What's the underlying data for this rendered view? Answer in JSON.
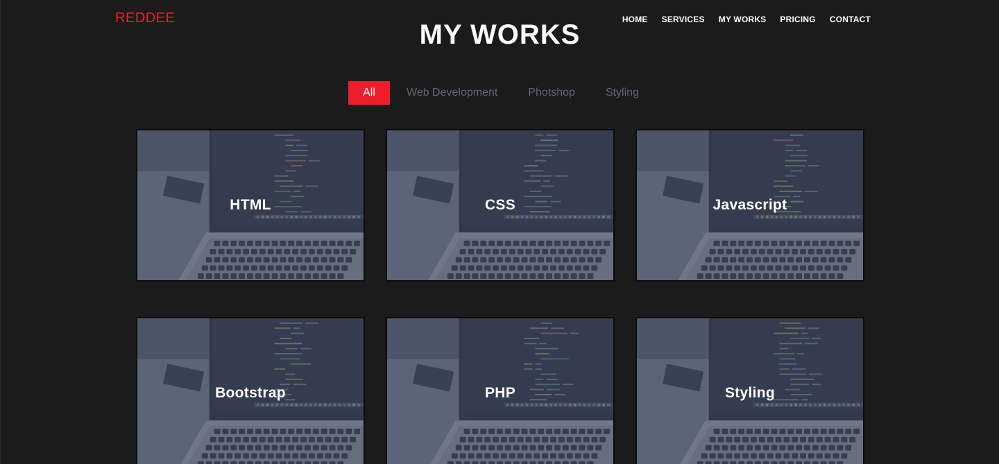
{
  "brand": {
    "logo": "REDDEE",
    "accent_color": "#ef1d2a"
  },
  "nav": {
    "items": [
      {
        "label": "HOME"
      },
      {
        "label": "SERVICES"
      },
      {
        "label": "MY WORKS"
      },
      {
        "label": "PRICING"
      },
      {
        "label": "CONTACT"
      }
    ]
  },
  "section": {
    "title": "MY WORKS"
  },
  "filters": {
    "active": "All",
    "items": [
      {
        "label": "All"
      },
      {
        "label": "Web Development"
      },
      {
        "label": "Photshop"
      },
      {
        "label": "Styling"
      }
    ]
  },
  "works": {
    "items": [
      {
        "label": "HTML",
        "image_icon": "laptop-code-photo"
      },
      {
        "label": "CSS",
        "image_icon": "laptop-code-photo"
      },
      {
        "label": "Javascript",
        "image_icon": "laptop-code-photo"
      },
      {
        "label": "Bootstrap",
        "image_icon": "laptop-code-photo"
      },
      {
        "label": "PHP",
        "image_icon": "laptop-code-photo"
      },
      {
        "label": "Styling",
        "image_icon": "laptop-code-photo"
      }
    ]
  }
}
